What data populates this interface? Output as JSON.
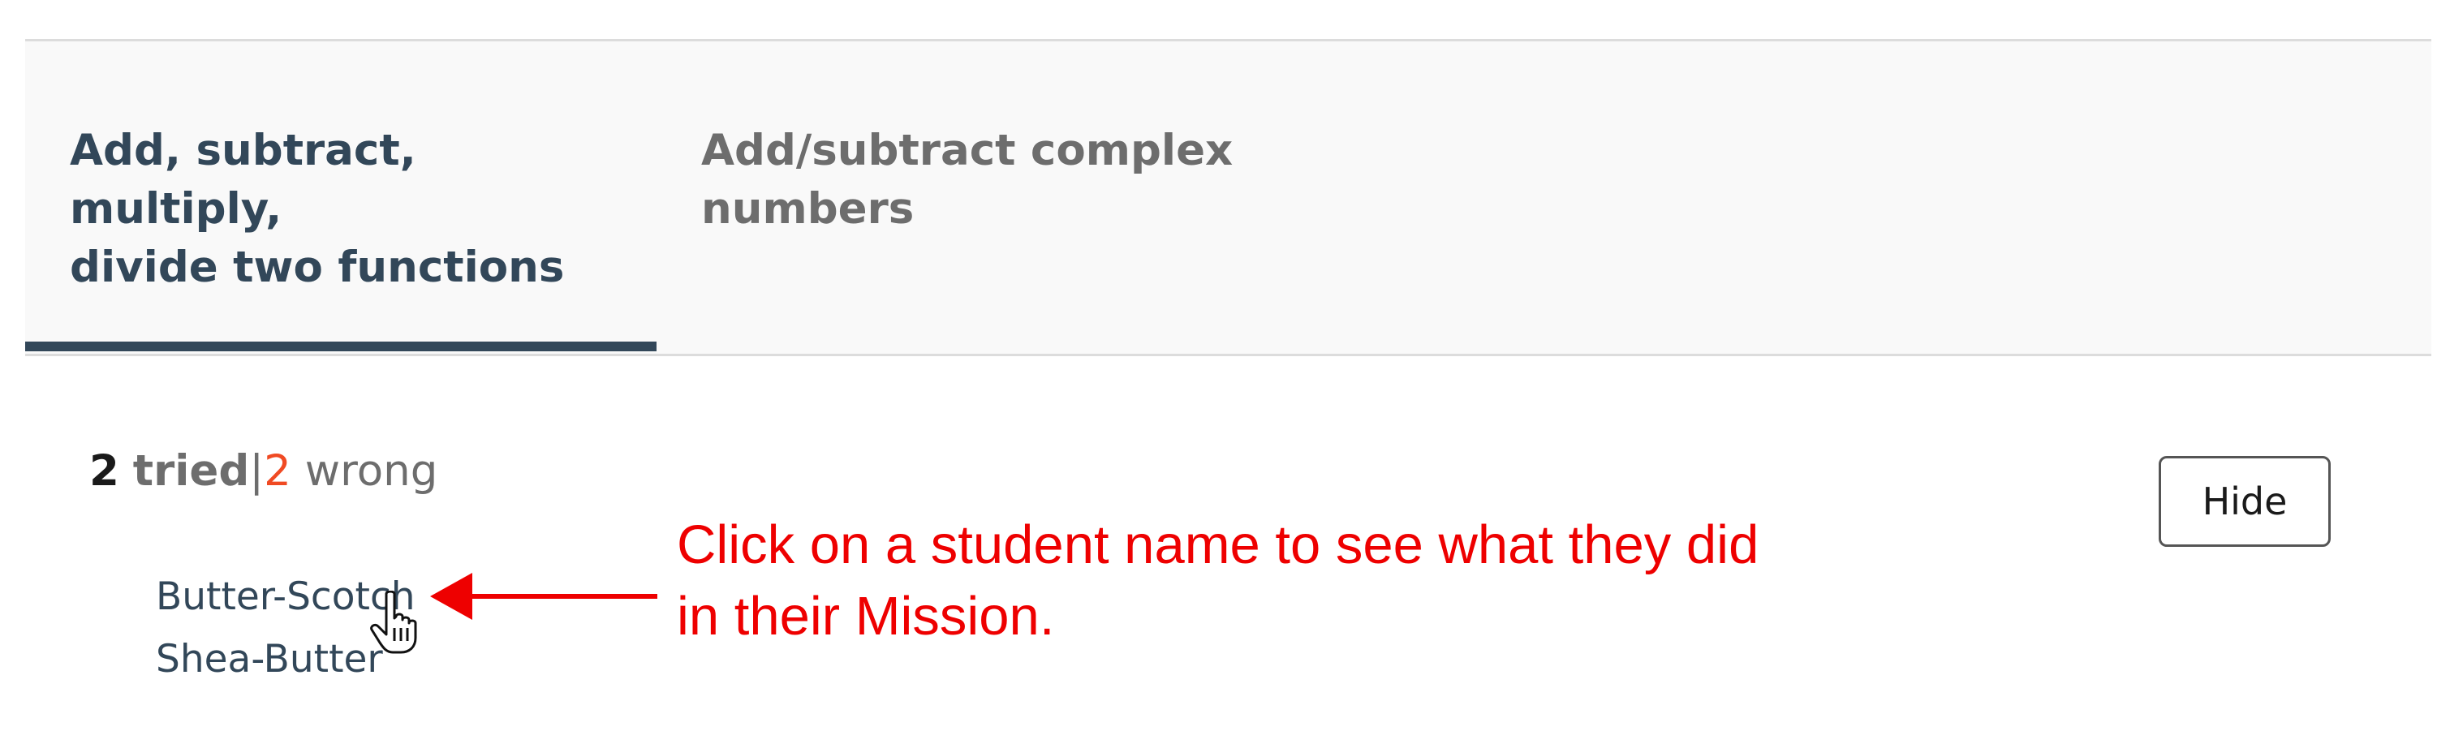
{
  "tabs": [
    {
      "label": "Add, subtract, multiply,\ndivide two functions",
      "active": true
    },
    {
      "label": "Add/subtract complex\nnumbers",
      "active": false
    }
  ],
  "stats": {
    "tried_count": "2",
    "tried_label": "tried",
    "separator": "|",
    "wrong_count": "2",
    "wrong_label": "wrong"
  },
  "students": [
    "Butter-Scotch",
    "Shea-Butter"
  ],
  "annotation": "Click on a student name to see what they did in their Mission.",
  "hide_button": "Hide",
  "icons": {
    "cursor": "hand-pointer-icon",
    "arrow": "arrow-left-icon"
  },
  "colors": {
    "active_tab": "#324759",
    "wrong_count": "#f04a23",
    "annotation": "#ee0000"
  }
}
